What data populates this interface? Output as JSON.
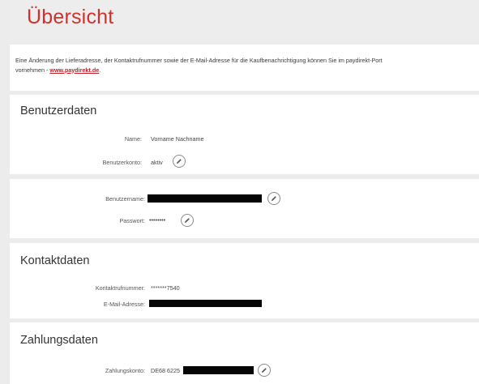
{
  "header": {
    "title": "Übersicht"
  },
  "intro": {
    "line1": "Eine Änderung der Lieferadresse, der Kontaktrufnummer sowie der E-Mail-Adresse für die Kaufbenachrichtigung können Sie im paydirekt-Port",
    "line2_prefix": "vornehmen - ",
    "link": "www.paydirekt.de",
    "line2_suffix": "."
  },
  "benutzerdaten": {
    "title": "Benutzerdaten",
    "name_label": "Name:",
    "name_value": "Vorname Nachname",
    "account_label": "Benutzerkonto:",
    "account_value": "aktiv",
    "account_edit_icon": "pencil-icon"
  },
  "credentials": {
    "username_label": "Benutzername:",
    "username_value": "",
    "username_edit_icon": "pencil-icon",
    "password_label": "Passwort:",
    "password_value": "••••••••",
    "password_edit_icon": "pencil-icon"
  },
  "kontaktdaten": {
    "title": "Kontaktdaten",
    "phone_label": "Kontaktrufnummer:",
    "phone_value": "*******7540",
    "email_label": "E-Mail-Adresse:",
    "email_value": ""
  },
  "zahlungsdaten": {
    "title": "Zahlungsdaten",
    "account_label": "Zahlungskonto:",
    "account_value_prefix": "DE68 6225",
    "account_edit_icon": "pencil-icon"
  },
  "colors": {
    "accent_red": "#d0312d",
    "link_red": "#c01f27",
    "background_gray": "#ececec",
    "card_white": "#ffffff",
    "redaction_black": "#050505"
  }
}
